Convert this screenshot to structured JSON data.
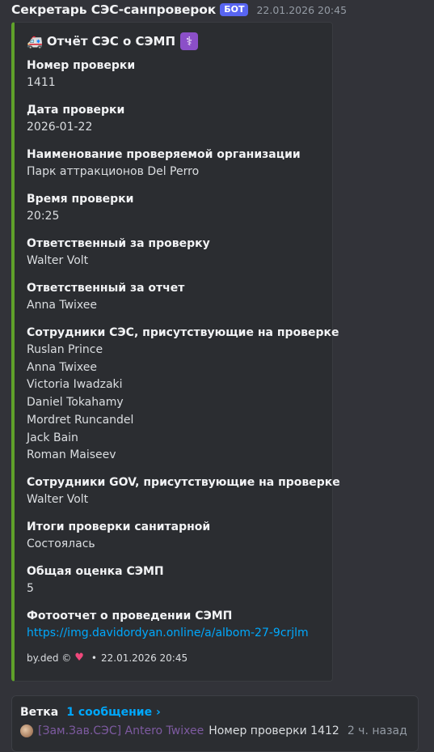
{
  "message": {
    "author": "Секретарь СЭС-санпроверок",
    "bot_tag": "БОТ",
    "timestamp": "22.01.2026 20:45"
  },
  "embed": {
    "accent_color": "#5fa12a",
    "title_icon": "ambulance-icon",
    "title": "Отчёт СЭС о СЭМП",
    "title_badge_icon": "medical-symbol-icon",
    "fields": [
      {
        "name": "Номер проверки",
        "value": "1411"
      },
      {
        "name": "Дата проверки",
        "value": "2026-01-22"
      },
      {
        "name": "Наименование проверяемой организации",
        "value": "Парк аттракционов Del Perro"
      },
      {
        "name": "Время проверки",
        "value": "20:25"
      },
      {
        "name": "Ответственный за проверку",
        "value": "Walter Volt"
      },
      {
        "name": "Ответственный за отчет",
        "value": "Anna Twixee"
      },
      {
        "name": "Сотрудники СЭС, присутствующие на проверке",
        "values": [
          "Ruslan Prince",
          "Anna Twixee",
          "Victoria Iwadzaki",
          "Daniel Tokahamy",
          "Mordret Runcandel",
          "Jack Bain",
          "Roman Maiseev"
        ]
      },
      {
        "name": "Сотрудники GOV, присутствующие на проверке",
        "value": "Walter Volt"
      },
      {
        "name": "Итоги проверки санитарной",
        "value": "Состоялась"
      },
      {
        "name": "Общая оценка СЭМП",
        "value": "5"
      },
      {
        "name": "Фотоотчет о проведении СЭМП",
        "value": "https://img.davidordyan.online/a/albom-27-9crjlm"
      }
    ],
    "footer": {
      "text": "by.ded ©",
      "icon": "heart-icon",
      "separator": "•",
      "timestamp": "22.01.2026 20:45"
    }
  },
  "thread": {
    "label": "Ветка",
    "count_label": "1 сообщение ›",
    "last_message": {
      "author": "[Зам.Зав.СЭС] Antero Twixee",
      "text": "Номер проверки 1412",
      "time": "2 ч. назад"
    }
  }
}
